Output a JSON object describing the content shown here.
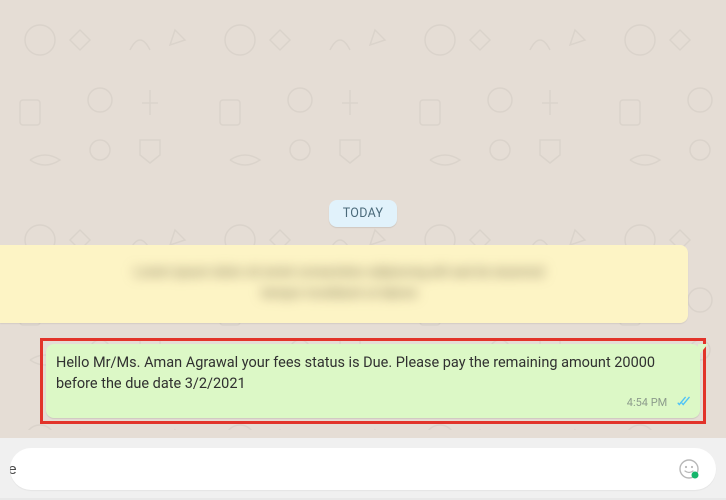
{
  "date_divider": {
    "label": "TODAY"
  },
  "system_banner": {
    "line1": "Lorem ipsum dolor sit amet consectetur adipiscing elit sed do eiusmod",
    "line2": "tempor incididunt ut labore"
  },
  "message": {
    "text": "Hello Mr/Ms. Aman Agrawal your fees status is Due. Please pay the remaining amount 20000 before the due date 3/2/2021",
    "time": "4:54 PM",
    "status": "read"
  },
  "composer": {
    "placeholder": "",
    "partial_text": "ge"
  },
  "colors": {
    "chat_bg": "#e5ddd5",
    "bubble_out": "#dcf8c6",
    "date_badge_bg": "#e1f2fb",
    "system_banner_bg": "#fdf4c5",
    "highlight_border": "#e2332a",
    "tick_read": "#4fc3f7"
  }
}
